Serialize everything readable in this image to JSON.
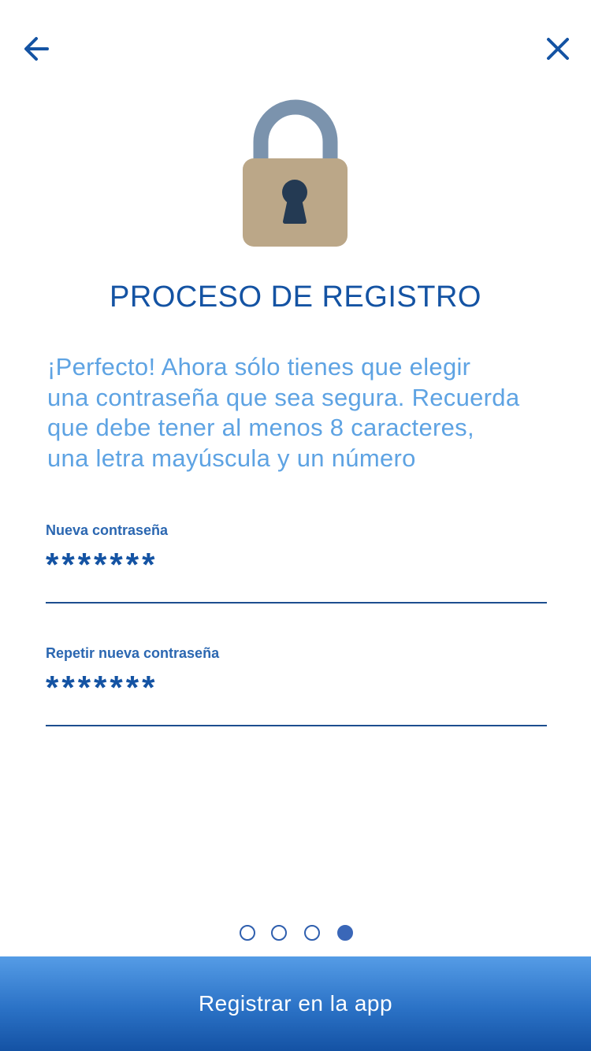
{
  "header": {
    "back_icon": "arrow-left-icon",
    "close_icon": "close-icon"
  },
  "hero": {
    "icon": "padlock-icon",
    "colors": {
      "shackle": "#7b93ad",
      "body": "#bba788",
      "keyhole": "#243a53"
    }
  },
  "title": "PROCESO DE REGISTRO",
  "instructions": {
    "line1": "¡Perfecto! Ahora sólo tienes que elegir",
    "line2": "una contraseña que sea segura. Recuerda",
    "line3": "que debe tener al menos 8 caracteres,",
    "line4": "una letra mayúscula y un número"
  },
  "form": {
    "new_password": {
      "label": "Nueva contraseña",
      "value": "*******"
    },
    "repeat_password": {
      "label": "Repetir nueva contraseña",
      "value": "*******"
    }
  },
  "pager": {
    "total": 4,
    "active_index": 3
  },
  "cta": {
    "label": "Registrar en la app"
  },
  "colors": {
    "title": "#1453a3",
    "instructions": "#5ea3e3",
    "field_label": "#2b67b1",
    "underline": "#1d4e8f",
    "cta_top": "#559ce6",
    "cta_bottom": "#1452a4"
  }
}
